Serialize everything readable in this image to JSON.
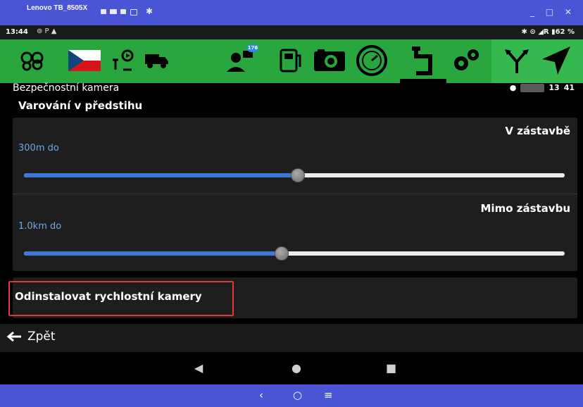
{
  "window": {
    "title": "Lenovo TB_8505X",
    "controls": "_ □ ✕"
  },
  "status_bar": {
    "time": "13:44",
    "left_icons": "⊚ P ▲",
    "right": "✱ ⊙ ◢R ▮62 %"
  },
  "toolbar": {
    "badge": "176",
    "icons": [
      "gears-icon",
      "czech-flag-icon",
      "route-settings-icon",
      "truck-icon",
      "contacts-icon",
      "fuel-icon",
      "camera-icon",
      "speedometer-icon",
      "road-icon",
      "settings-icon",
      "fork-icon",
      "navigate-icon"
    ]
  },
  "header": {
    "screen_title": "Bezpečnostní kamera",
    "section_title": "Varování v předstihu",
    "right_num1": "13",
    "right_num2": "41"
  },
  "sliders": [
    {
      "label": "V zástavbě",
      "value_text": "300m do",
      "fraction": 0.505
    },
    {
      "label": "Mimo zástavbu",
      "value_text": "1.0km do",
      "fraction": 0.475
    }
  ],
  "actions": {
    "uninstall": "Odinstalovat rychlostní kamery",
    "back": "Zpět"
  },
  "colors": {
    "toolbar": "#2aa63e",
    "accent": "#3b78d8",
    "host_bar": "#4a55d6",
    "highlight_border": "#e03a3a"
  }
}
